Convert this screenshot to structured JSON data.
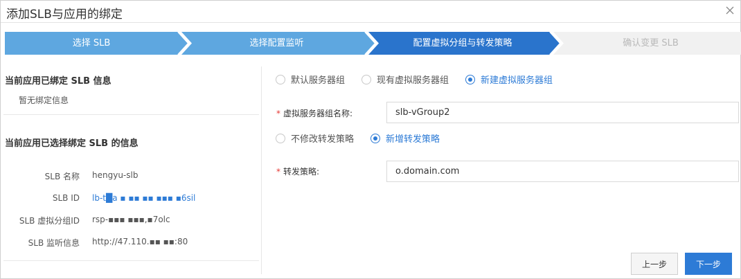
{
  "dialog": {
    "title": "添加SLB与应用的绑定",
    "close_icon": "close-icon"
  },
  "steps": [
    {
      "label": "选择 SLB",
      "state": "done"
    },
    {
      "label": "选择配置监听",
      "state": "done"
    },
    {
      "label": "配置虚拟分组与转发策略",
      "state": "active"
    },
    {
      "label": "确认变更 SLB",
      "state": "pending"
    }
  ],
  "colors": {
    "step_done": "#5ea7e0",
    "step_active": "#2a74cc",
    "step_pending": "#f1f1f1",
    "accent": "#2d7bd6",
    "required": "#e53935"
  },
  "left": {
    "bound_title": "当前应用已绑定 SLB 信息",
    "bound_empty": "暂无绑定信息",
    "selected_title": "当前应用已选择绑定 SLB 的信息",
    "fields": [
      {
        "key": "SLB 名称",
        "value": "hengyu-slb"
      },
      {
        "key": "SLB ID",
        "value": "lb-t█a ▪ ▪▪ ▪▪ ▪▪▪ ▪6sil"
      },
      {
        "key": "SLB 虚拟分组ID",
        "value": "rsp-▪▪▪ ▪▪▪,▪7olc"
      },
      {
        "key": "SLB 监听信息",
        "value": "http://47.110.▪▪ ▪▪:80"
      }
    ]
  },
  "right": {
    "group_options": [
      {
        "label": "默认服务器组",
        "checked": false
      },
      {
        "label": "现有虚拟服务器组",
        "checked": false
      },
      {
        "label": "新建虚拟服务器组",
        "checked": true
      }
    ],
    "group_name_label": "虚拟服务器组名称:",
    "group_name_value": "slb-vGroup2",
    "policy_options": [
      {
        "label": "不修改转发策略",
        "checked": false
      },
      {
        "label": "新增转发策略",
        "checked": true
      }
    ],
    "policy_label": "转发策略:",
    "policy_value": "o.domain.com",
    "required_mark": "*"
  },
  "footer": {
    "prev_label": "上一步",
    "next_label": "下一步"
  }
}
